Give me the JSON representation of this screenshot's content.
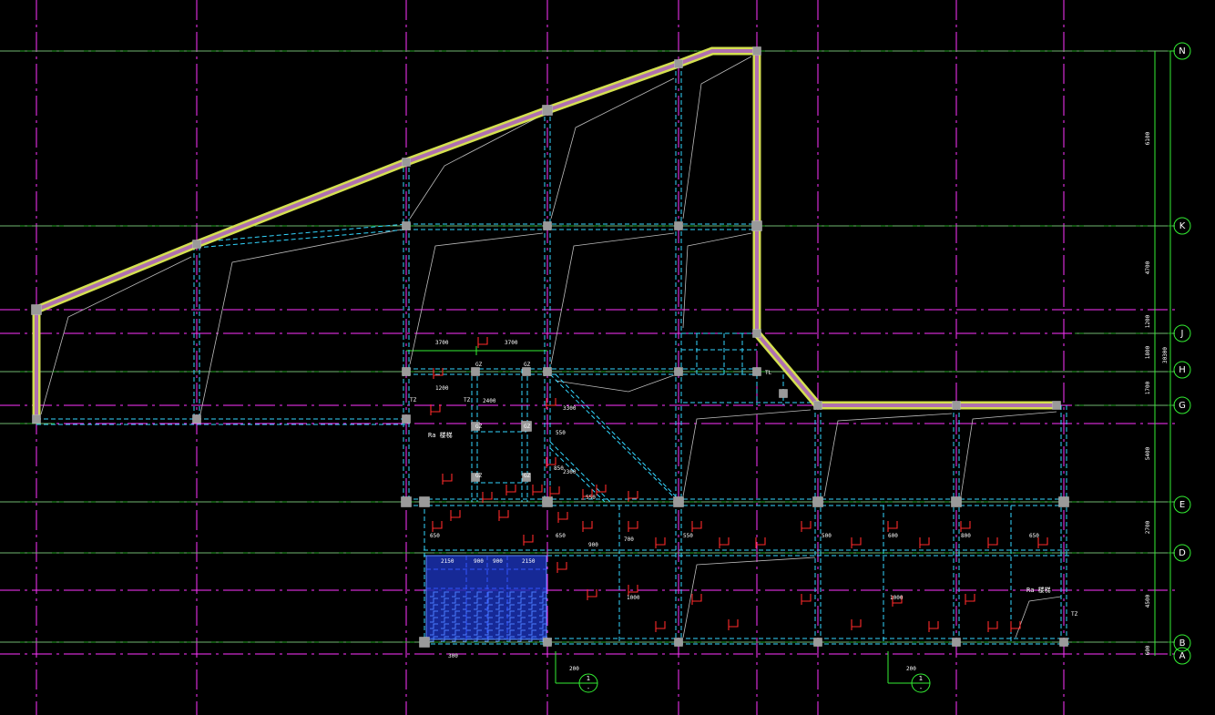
{
  "drawing": {
    "background": "#000000",
    "grid_color": "#ff33ff",
    "dimension_color": "#33ee33",
    "beam_color": "#33d6ff",
    "wall_color": "#d4e050",
    "rebar_color": "#ff2a2a"
  },
  "axes": [
    {
      "id": "N",
      "label": "N"
    },
    {
      "id": "K",
      "label": "K"
    },
    {
      "id": "J",
      "label": "J"
    },
    {
      "id": "H",
      "label": "H"
    },
    {
      "id": "G",
      "label": "G"
    },
    {
      "id": "E",
      "label": "E"
    },
    {
      "id": "D",
      "label": "D"
    },
    {
      "id": "B",
      "label": "B"
    },
    {
      "id": "A",
      "label": "A"
    }
  ],
  "right_dimensions": [
    "6100",
    "4700",
    "1200",
    "1800",
    "1700",
    "5400",
    "2700",
    "4500",
    "600"
  ],
  "overall_dimension": "30300",
  "section_marks": [
    {
      "id": "s1",
      "top": "1",
      "bottom": "-"
    },
    {
      "id": "s2",
      "top": "1",
      "bottom": "-"
    }
  ],
  "dims_top": {
    "a": "3700",
    "b": "3700"
  },
  "labels": {
    "room_left": "Ra 楼梯",
    "room_right": "Ra 楼梯",
    "tz1": "TZ",
    "tz2": "TZ",
    "tz3": "TZ",
    "gz1": "GZ",
    "gz2": "GZ",
    "gz3": "GZ",
    "gz4": "GZ",
    "gz5": "GZ",
    "gz6": "GZ",
    "tl": "TL",
    "r01": "1200",
    "r02": "2400",
    "r03": "3300",
    "r04": "2300",
    "r05": "850",
    "r06": "550",
    "r07": "550",
    "r08": "650",
    "r09": "650",
    "r10": "700",
    "r11": "550",
    "r12": "600",
    "r13": "650",
    "r14": "900",
    "r15": "1000",
    "r16": "1000",
    "r17": "500",
    "r18": "800",
    "r19": "2150",
    "r20": "900",
    "r21": "900",
    "r22": "2150",
    "r23": "300",
    "r24": "200",
    "r25": "200"
  }
}
